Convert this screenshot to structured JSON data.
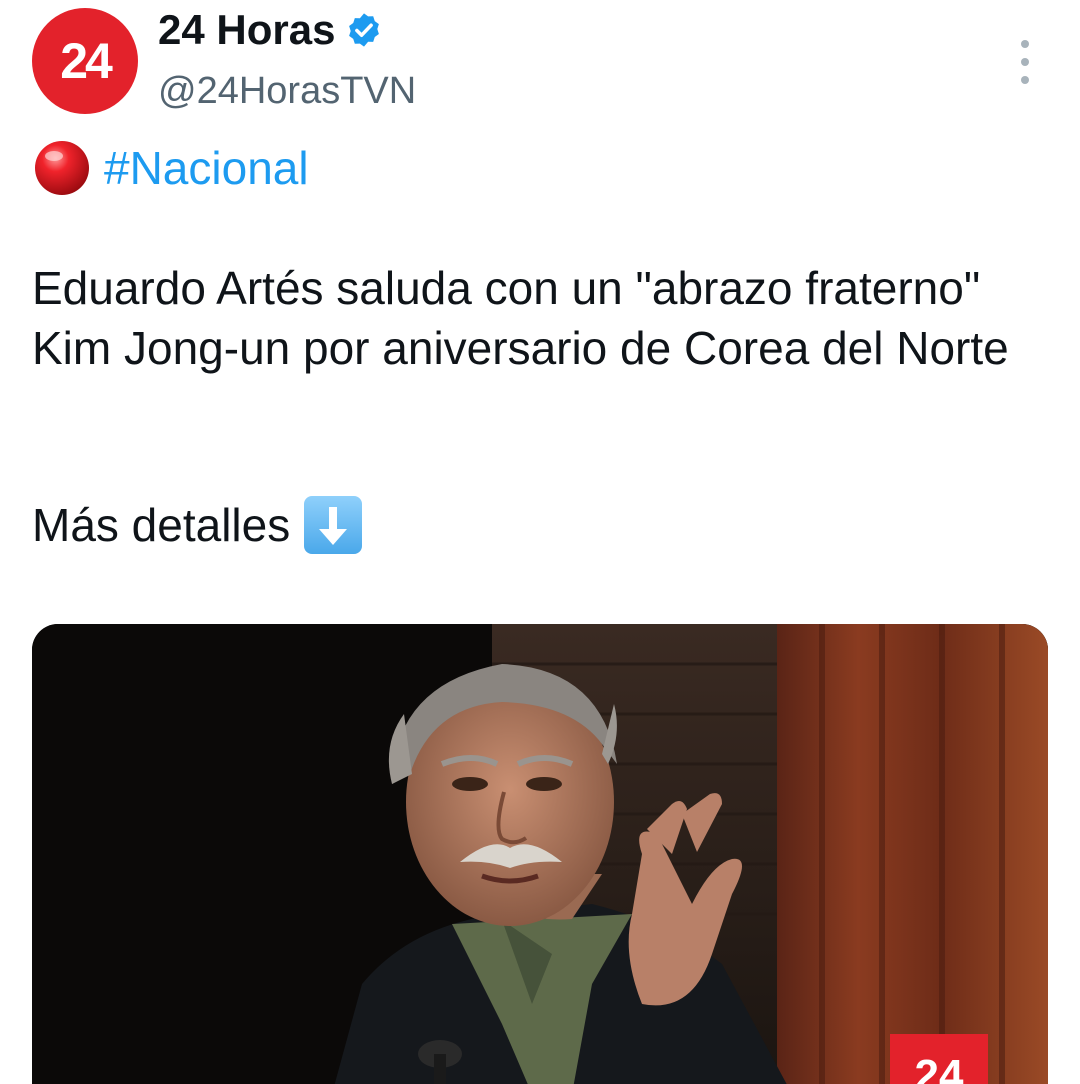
{
  "author": {
    "avatar_text": "24",
    "display_name": "24 Horas",
    "handle": "@24HorasTVN",
    "verified": true
  },
  "tweet": {
    "hashtag": "#Nacional",
    "text": "Eduardo Artés saluda con un \"abrazo fraterno\" Kim Jong-un por aniversario de Corea del Norte",
    "more_details": "Más detalles"
  },
  "media": {
    "watermark_text": "24"
  },
  "icons": {
    "verified": "verified-badge-icon",
    "more": "more-options-icon",
    "hashtag_emoji": "red-circle-emoji",
    "arrow_emoji": "down-arrow-emoji"
  },
  "colors": {
    "brand_red": "#e3222b",
    "link_blue": "#1d9bf0",
    "handle_gray": "#536471"
  }
}
